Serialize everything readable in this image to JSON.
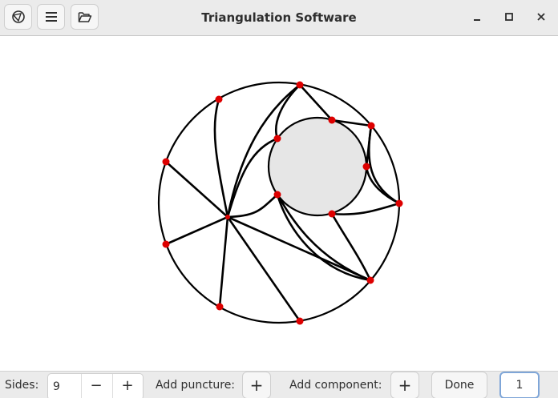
{
  "window": {
    "title": "Triangulation Software",
    "icons": {
      "app": "app-logo-icon",
      "menu": "hamburger-menu-icon",
      "open": "folder-open-icon",
      "minimize": "minimize-icon",
      "maximize": "maximize-icon",
      "close": "close-icon"
    }
  },
  "controls": {
    "sides_label": "Sides:",
    "sides_value": "9",
    "decrement_label": "−",
    "increment_label": "+",
    "add_puncture_label": "Add puncture:",
    "add_puncture_button": "+",
    "add_component_label": "Add component:",
    "add_component_button": "+",
    "done_label": "Done",
    "count_value": "1"
  },
  "colors": {
    "vertex": "#dd0000",
    "puncture_fill": "#e6e6e6",
    "stroke": "#000000"
  }
}
